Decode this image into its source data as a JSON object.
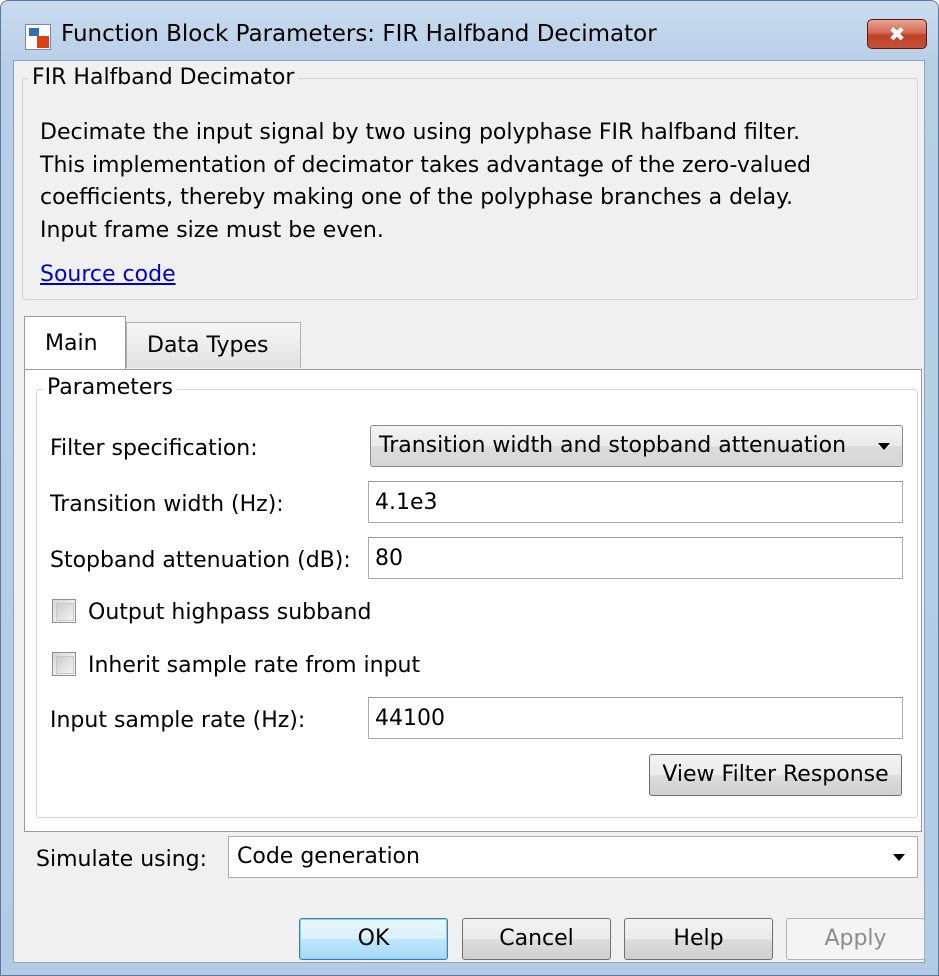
{
  "window": {
    "title": "Function Block Parameters: FIR Halfband Decimator",
    "close_glyph": "✖"
  },
  "description_group": {
    "legend": "FIR Halfband Decimator",
    "lines": [
      "Decimate the input signal by two using polyphase FIR halfband filter.",
      "This implementation of decimator takes advantage of the zero-valued",
      "coefficients, thereby making one of the polyphase branches a delay.",
      "Input frame size must be even."
    ],
    "link": "Source code"
  },
  "tabs": [
    {
      "label": "Main",
      "active": true
    },
    {
      "label": "Data Types",
      "active": false
    }
  ],
  "parameters": {
    "legend": "Parameters",
    "filter_spec": {
      "label": "Filter specification:",
      "value": "Transition width and stopband attenuation"
    },
    "transition_width": {
      "label": "Transition width (Hz):",
      "value": "4.1e3"
    },
    "stopband_atten": {
      "label": "Stopband attenuation (dB):",
      "value": "80"
    },
    "output_highpass": {
      "label": "Output highpass subband",
      "checked": false
    },
    "inherit_rate": {
      "label": "Inherit sample rate from input",
      "checked": false
    },
    "input_rate": {
      "label": "Input sample rate (Hz):",
      "value": "44100"
    },
    "view_response": "View Filter Response"
  },
  "simulate": {
    "label": "Simulate using:",
    "value": "Code generation"
  },
  "buttons": {
    "ok": "OK",
    "cancel": "Cancel",
    "help": "Help",
    "apply": "Apply"
  }
}
